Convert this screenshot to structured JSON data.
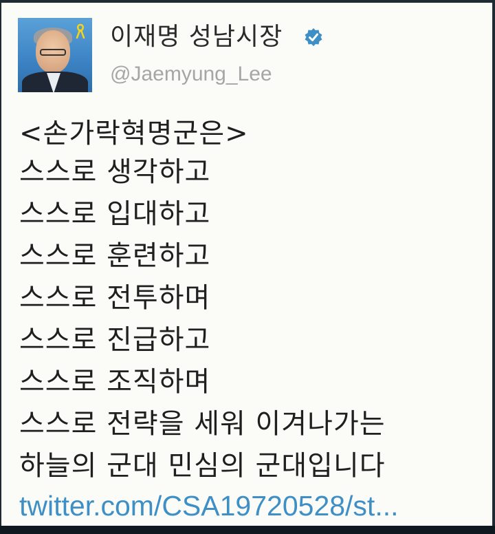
{
  "account": {
    "name": "이재명 성남시장",
    "handle": "@Jaemyung_Lee",
    "verified_icon": "verified-badge-icon",
    "verified_color": "#3d8fc5"
  },
  "tweet": {
    "lines": [
      "<손가락혁명군은>",
      "스스로 생각하고",
      "스스로 입대하고",
      "스스로 훈련하고",
      "스스로 전투하며",
      "스스로 진급하고",
      "스스로 조직하며",
      "스스로 전략을 세워 이겨나가는",
      "하늘의 군대 민심의 군대입니다"
    ],
    "link": "twitter.com/CSA19720528/st..."
  },
  "colors": {
    "card_background": "#fbfbf7",
    "text": "#1f1f1f",
    "handle": "#a6a6a6",
    "link": "#3d8fc5"
  }
}
